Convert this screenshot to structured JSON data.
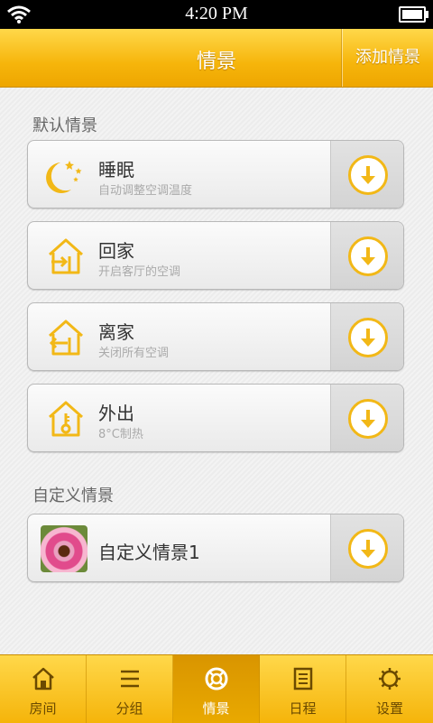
{
  "status_bar": {
    "time": "4:20 PM",
    "battery_level": 0.85
  },
  "header": {
    "title": "情景",
    "add_button": "添加情景"
  },
  "default_section": {
    "label": "默认情景",
    "scenes": [
      {
        "name": "睡眠",
        "desc": "自动调整空调温度",
        "icon": "moon-stars-icon"
      },
      {
        "name": "回家",
        "desc": "开启客厅的空调",
        "icon": "house-enter-icon"
      },
      {
        "name": "离家",
        "desc": "关闭所有空调",
        "icon": "house-exit-icon"
      },
      {
        "name": "外出",
        "desc": "8°C制热",
        "icon": "house-thermometer-icon"
      }
    ]
  },
  "custom_section": {
    "label": "自定义情景",
    "scenes": [
      {
        "name": "自定义情景1",
        "icon": "flower-photo-thumbnail"
      }
    ]
  },
  "tabs": [
    {
      "label": "房间",
      "icon": "house-icon",
      "active": false
    },
    {
      "label": "分组",
      "icon": "list-icon",
      "active": false
    },
    {
      "label": "情景",
      "icon": "lifebuoy-icon",
      "active": true
    },
    {
      "label": "日程",
      "icon": "calendar-icon",
      "active": false
    },
    {
      "label": "设置",
      "icon": "gear-icon",
      "active": false
    }
  ],
  "colors": {
    "accent": "#f2b817",
    "header": "#f6b50b",
    "active_tab": "#e0a000"
  }
}
